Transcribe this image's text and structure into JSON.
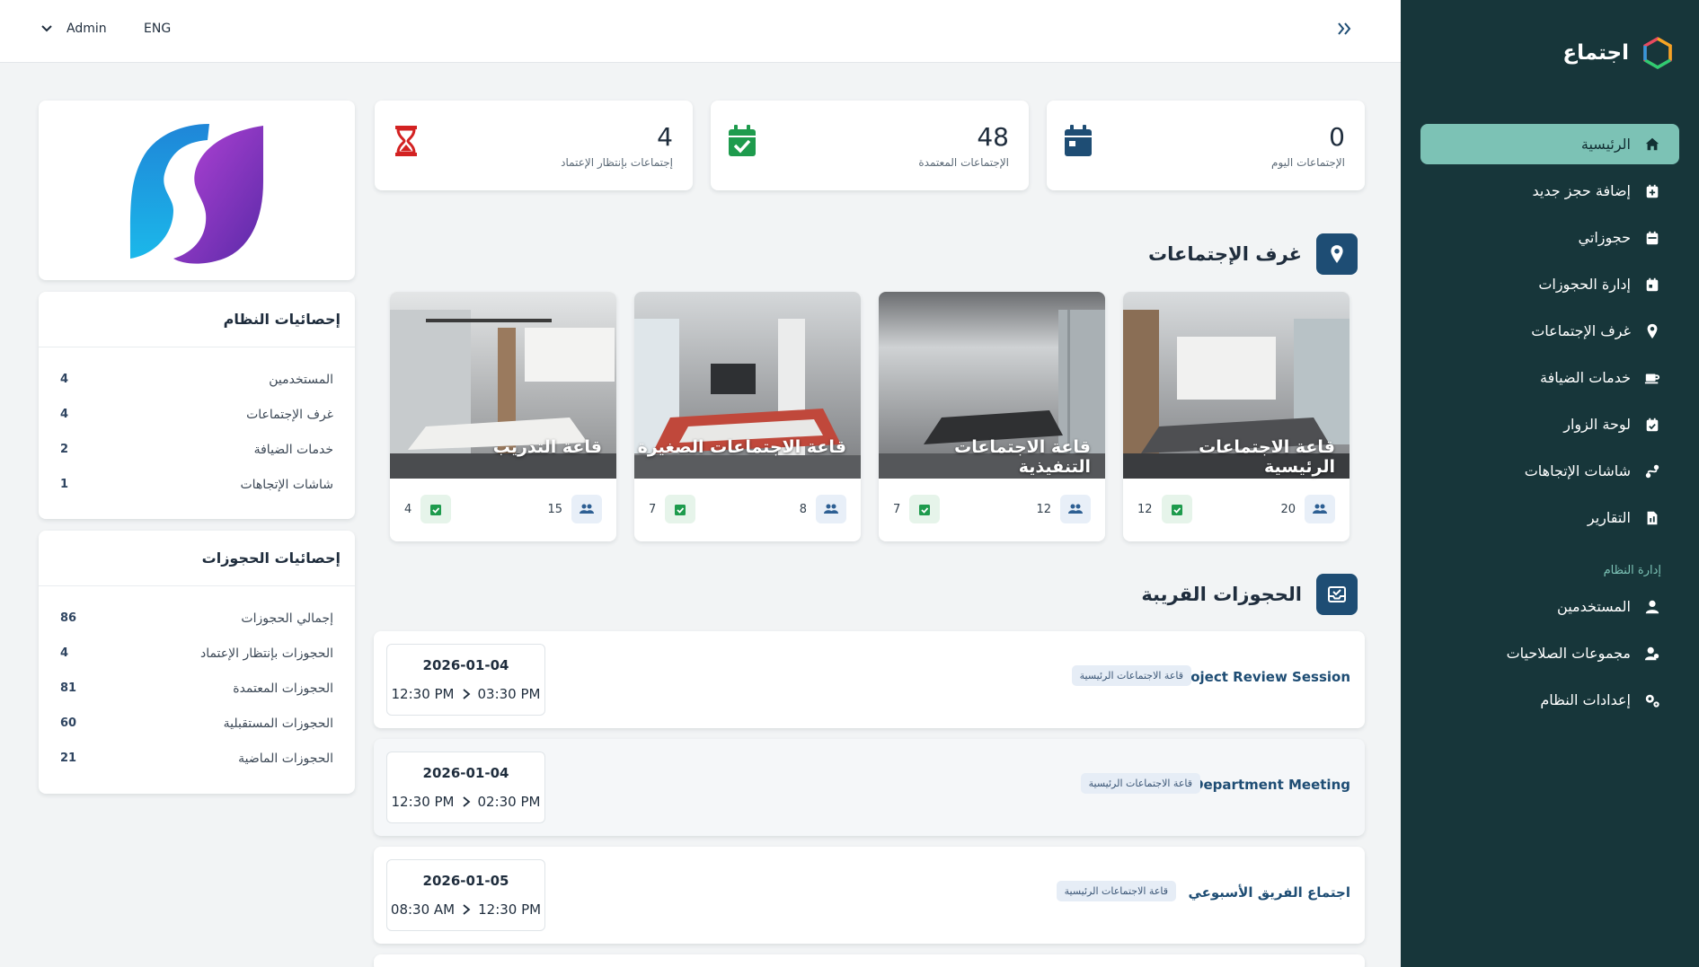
{
  "app": {
    "name": "اجتماع"
  },
  "topbar": {
    "user": "Admin",
    "lang": "ENG"
  },
  "sidebar": {
    "items": [
      {
        "label": "الرئيسية",
        "icon": "home-icon",
        "active": true
      },
      {
        "label": "إضافة حجز جديد",
        "icon": "calendar-plus-icon"
      },
      {
        "label": "حجوزاتي",
        "icon": "calendar-icon"
      },
      {
        "label": "إدارة الحجوزات",
        "icon": "calendar-manage-icon"
      },
      {
        "label": "غرف الإجتماعات",
        "icon": "location-pin-icon"
      },
      {
        "label": "خدمات الضيافة",
        "icon": "coffee-icon"
      },
      {
        "label": "لوحة الزوار",
        "icon": "visitor-board-icon"
      },
      {
        "label": "شاشات الإتجاهات",
        "icon": "directions-icon"
      },
      {
        "label": "التقارير",
        "icon": "report-icon"
      }
    ],
    "section_label": "إدارة النظام",
    "admin_items": [
      {
        "label": "المستخدمين",
        "icon": "user-icon"
      },
      {
        "label": "مجموعات الصلاحيات",
        "icon": "user-group-icon"
      },
      {
        "label": "إعدادات النظام",
        "icon": "gears-icon"
      }
    ]
  },
  "stats": [
    {
      "value": "0",
      "label": "الإجتماعات اليوم",
      "color": "#1e4d74"
    },
    {
      "value": "48",
      "label": "الإجتماعات المعتمدة",
      "color": "#1e9b4d"
    },
    {
      "value": "4",
      "label": "إجتماعات بإنتظار الإعتماد",
      "color": "#d32222"
    }
  ],
  "rooms_section": {
    "title": "غرف الإجتماعات"
  },
  "rooms": [
    {
      "name": "قاعة الاجتماعات الرئيسية",
      "capacity": "20",
      "bookings": "12"
    },
    {
      "name": "قاعة الاجتماعات التنفيذية",
      "capacity": "12",
      "bookings": "7"
    },
    {
      "name": "قاعة الاجتماعات الصغيرة",
      "capacity": "8",
      "bookings": "7"
    },
    {
      "name": "قاعة التدريب",
      "capacity": "15",
      "bookings": "4"
    }
  ],
  "bookings_section": {
    "title": "الحجوزات القريبة"
  },
  "bookings": [
    {
      "title": "Project Review Session",
      "room": "قاعة الاجتماعات الرئيسية",
      "date": "2026-01-04",
      "start": "12:30 PM",
      "end": "03:30 PM"
    },
    {
      "title": "Department Meeting",
      "room": "قاعة الاجتماعات الرئيسية",
      "date": "2026-01-04",
      "start": "12:30 PM",
      "end": "02:30 PM"
    },
    {
      "title": "اجتماع الفريق الأسبوعي",
      "room": "قاعة الاجتماعات الرئيسية",
      "date": "2026-01-05",
      "start": "08:30 AM",
      "end": "12:30 PM"
    }
  ],
  "system_stats": {
    "title": "إحصائيات النظام",
    "rows": [
      {
        "label": "المستخدمين",
        "value": "4"
      },
      {
        "label": "غرف الإجتماعات",
        "value": "4"
      },
      {
        "label": "خدمات الضيافة",
        "value": "2"
      },
      {
        "label": "شاشات الإتجاهات",
        "value": "1"
      }
    ]
  },
  "booking_stats": {
    "title": "إحصائيات الحجوزات",
    "rows": [
      {
        "label": "إجمالي الحجوزات",
        "value": "86"
      },
      {
        "label": "الحجوزات بإنتظار الإعتماد",
        "value": "4"
      },
      {
        "label": "الحجوزات المعتمدة",
        "value": "81"
      },
      {
        "label": "الحجوزات المستقبلية",
        "value": "60"
      },
      {
        "label": "الحجوزات الماضية",
        "value": "21"
      }
    ]
  },
  "colors": {
    "sidebar_bg": "#17363a",
    "active_item": "#7cc2b5",
    "primary": "#1e4d74"
  }
}
